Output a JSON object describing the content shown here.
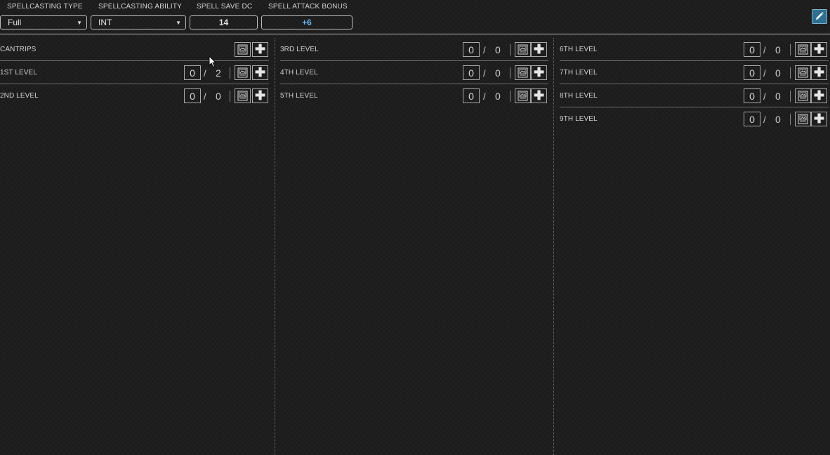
{
  "header": {
    "spellcasting_type_label": "SPELLCASTING TYPE",
    "spellcasting_ability_label": "SPELLCASTING ABILITY",
    "spell_save_dc_label": "SPELL SAVE DC",
    "spell_attack_bonus_label": "SPELL ATTACK BONUS",
    "spellcasting_type_value": "Full",
    "spellcasting_ability_value": "INT",
    "spell_save_dc_value": "14",
    "spell_attack_bonus_value": "+6",
    "attack_bonus_color": "#6db3f2",
    "edit_button_color": "#2f6f90"
  },
  "levels": {
    "cantrips": {
      "label": "CANTRIPS"
    },
    "level1": {
      "label": "1ST LEVEL",
      "used": "0",
      "sep": "/",
      "max": "2"
    },
    "level2": {
      "label": "2ND LEVEL",
      "used": "0",
      "sep": "/",
      "max": "0"
    },
    "level3": {
      "label": "3RD LEVEL",
      "used": "0",
      "sep": "/",
      "max": "0"
    },
    "level4": {
      "label": "4TH LEVEL",
      "used": "0",
      "sep": "/",
      "max": "0"
    },
    "level5": {
      "label": "5TH LEVEL",
      "used": "0",
      "sep": "/",
      "max": "0"
    },
    "level6": {
      "label": "6TH LEVEL",
      "used": "0",
      "sep": "/",
      "max": "0"
    },
    "level7": {
      "label": "7TH LEVEL",
      "used": "0",
      "sep": "/",
      "max": "0"
    },
    "level8": {
      "label": "8TH LEVEL",
      "used": "0",
      "sep": "/",
      "max": "0"
    },
    "level9": {
      "label": "9TH LEVEL",
      "used": "0",
      "sep": "/",
      "max": "0"
    }
  },
  "icons": {
    "edit": "pencil-icon",
    "spellbook": "spellbook-icon",
    "add": "plus-icon",
    "dropdown": "caret-down-icon",
    "cursor": "mouse-cursor-icon"
  },
  "glyphs": {
    "plus": "✚",
    "caret": "▼"
  }
}
